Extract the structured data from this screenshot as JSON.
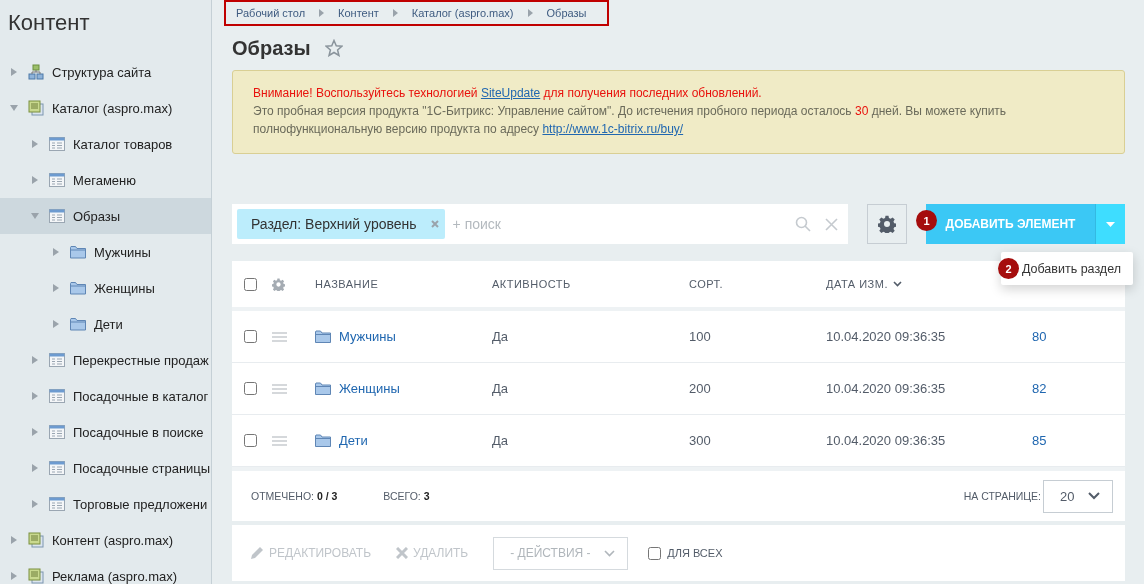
{
  "sidebar": {
    "title": "Контент",
    "tree": [
      {
        "label": "Структура сайта",
        "kind": "structure",
        "expanded": false,
        "selected": false
      },
      {
        "label": "Каталог (aspro.max)",
        "kind": "catalog",
        "expanded": true,
        "selected": false,
        "children": [
          {
            "label": "Каталог товаров",
            "kind": "iblock",
            "expanded": false,
            "selected": false
          },
          {
            "label": "Мегаменю",
            "kind": "iblock",
            "expanded": false,
            "selected": false
          },
          {
            "label": "Образы",
            "kind": "iblock",
            "expanded": true,
            "selected": true,
            "children": [
              {
                "label": "Мужчины",
                "kind": "folder",
                "expanded": false,
                "selected": false
              },
              {
                "label": "Женщины",
                "kind": "folder",
                "expanded": false,
                "selected": false
              },
              {
                "label": "Дети",
                "kind": "folder",
                "expanded": false,
                "selected": false
              }
            ]
          },
          {
            "label": "Перекрестные продаж",
            "kind": "iblock",
            "expanded": false,
            "selected": false
          },
          {
            "label": "Посадочные в каталог",
            "kind": "iblock",
            "expanded": false,
            "selected": false
          },
          {
            "label": "Посадочные в поиске",
            "kind": "iblock",
            "expanded": false,
            "selected": false
          },
          {
            "label": "Посадочные страницы",
            "kind": "iblock",
            "expanded": false,
            "selected": false
          },
          {
            "label": "Торговые предложени",
            "kind": "iblock",
            "expanded": false,
            "selected": false
          }
        ]
      },
      {
        "label": "Контент (aspro.max)",
        "kind": "catalog",
        "expanded": false,
        "selected": false
      },
      {
        "label": "Реклама (aspro.max)",
        "kind": "catalog",
        "expanded": false,
        "selected": false
      }
    ]
  },
  "breadcrumbs": [
    "Рабочий стол",
    "Контент",
    "Каталог (aspro.max)",
    "Образы"
  ],
  "page_title": "Образы",
  "favorite": false,
  "alert": {
    "lines": [
      {
        "warning": true,
        "segments": [
          {
            "kind": "text",
            "text": "Внимание! Воспользуйтесь технологией"
          },
          {
            "kind": "link",
            "text": "SiteUpdate"
          },
          {
            "kind": "text",
            "text": "для получения последних обновлений."
          }
        ]
      },
      {
        "warning": false,
        "segments": [
          {
            "kind": "text",
            "text": "Это пробная версия продукта \"1С-Битрикс: Управление сайтом\". До истечения пробного периода осталось"
          },
          {
            "kind": "accent",
            "text": "30"
          },
          {
            "kind": "text",
            "text": "дней. Вы можете купить полнофункциональную версию продукта по адресу"
          },
          {
            "kind": "link",
            "text": "http://www.1c-bitrix.ru/buy/"
          }
        ]
      }
    ]
  },
  "filter": {
    "tag": "Раздел: Верхний уровень",
    "placeholder": "+ поиск"
  },
  "add_button": {
    "label": "ДОБАВИТЬ ЭЛЕМЕНТ",
    "badge": "1"
  },
  "add_menu": {
    "items": [
      {
        "label": "Добавить раздел",
        "badge": "2"
      }
    ]
  },
  "table": {
    "columns": [
      "НАЗВАНИЕ",
      "АКТИВНОСТЬ",
      "СОРТ.",
      "ДАТА ИЗМ."
    ],
    "rows": [
      {
        "name": "Мужчины",
        "active": "Да",
        "sort": "100",
        "date": "10.04.2020 09:36:35",
        "column_6": "80",
        "checked": false
      },
      {
        "name": "Женщины",
        "active": "Да",
        "sort": "200",
        "date": "10.04.2020 09:36:35",
        "column_6": "82",
        "checked": false
      },
      {
        "name": "Дети",
        "active": "Да",
        "sort": "300",
        "date": "10.04.2020 09:36:35",
        "column_6": "85",
        "checked": false
      }
    ],
    "all_checked": false,
    "summary": [
      "ОТМЕЧЕНО: **0 / 3**",
      "ВСЕГО: **3**"
    ],
    "page_size_label": "НА СТРАНИЦЕ:",
    "page_size": "20"
  },
  "actions": {
    "edit": {
      "label": "РЕДАКТИРОВАТЬ",
      "disabled": true
    },
    "delete": {
      "label": "УДАЛИТЬ",
      "disabled": true
    },
    "select": "- ДЕЙСТВИЯ -",
    "for_all": {
      "label": "ДЛЯ ВСЕХ",
      "checked": false
    }
  }
}
